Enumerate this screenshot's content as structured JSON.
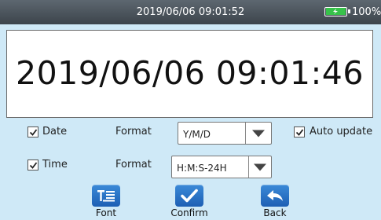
{
  "status_bar": {
    "datetime": "2019/06/06 09:01:52",
    "battery": "100%"
  },
  "clock": {
    "value": "2019/06/06  09:01:46"
  },
  "settings": {
    "date": {
      "label": "Date",
      "checked": true,
      "format_label": "Format",
      "format_value": "Y/M/D"
    },
    "time": {
      "label": "Time",
      "checked": true,
      "format_label": "Format",
      "format_value": "H:M:S-24H"
    },
    "auto_update": {
      "label": "Auto update",
      "checked": true
    }
  },
  "actions": {
    "font": {
      "label": "Font",
      "icon": "font-icon"
    },
    "confirm": {
      "label": "Confirm",
      "icon": "check-icon"
    },
    "back": {
      "label": "Back",
      "icon": "back-arrow-icon"
    }
  },
  "colors": {
    "button": "#2a74c9",
    "background": "#cfe9f7",
    "statusbar": "#4a535b"
  }
}
